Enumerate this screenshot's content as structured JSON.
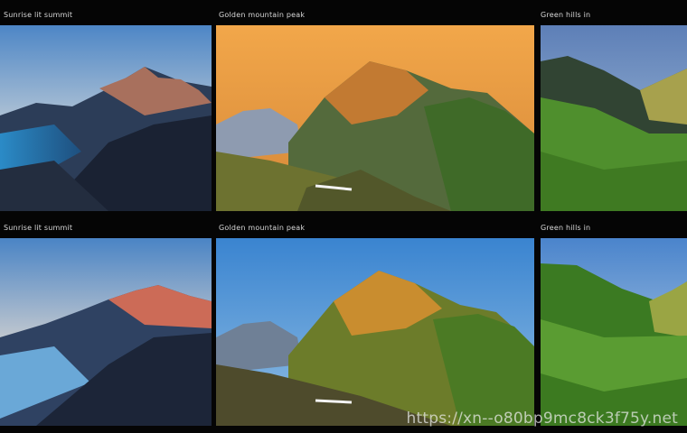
{
  "grid": {
    "captions": [
      "Sunrise lit summit",
      "Golden mountain peak",
      "Green hills in",
      "Sunrise lit summit",
      "Golden mountain peak",
      "Green hills in"
    ],
    "watermark": "https://xn--o80bp9mc8ck3f75y.net"
  },
  "colors": {
    "background": "#050505",
    "sky_orange": "#e5943b",
    "sky_blue": "#3e86c8",
    "green": "#5a9a32"
  }
}
